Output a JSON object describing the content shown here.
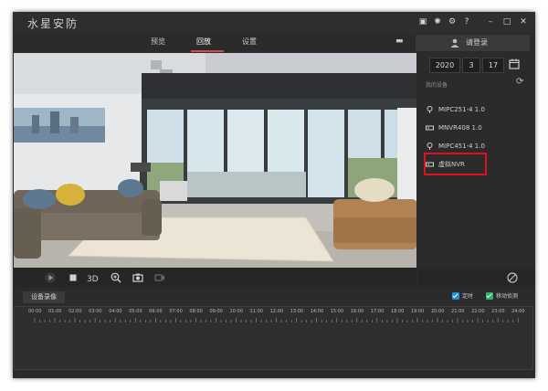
{
  "app": {
    "logo": "水星安防"
  },
  "nav": {
    "tabs": [
      {
        "label": "预览"
      },
      {
        "label": "回放"
      },
      {
        "label": "设置"
      }
    ],
    "active_tab": "回放",
    "login_label": "请登录"
  },
  "date": {
    "year": "2020",
    "month": "3",
    "day": "17"
  },
  "devices": {
    "section_title": "我的设备",
    "items": [
      {
        "name": "MIPC251-4 1.0",
        "icon": "camera-icon"
      },
      {
        "name": "MNVR408 1.0",
        "icon": "nvr-icon"
      },
      {
        "name": "MIPC451-4 1.0",
        "icon": "camera-icon"
      },
      {
        "name": "虚拟NVR",
        "icon": "nvr-icon",
        "highlighted": true
      }
    ]
  },
  "playback": {
    "device_record_label": "设备录像",
    "timed_label": "定时",
    "motion_label": "移动侦测",
    "timed_checked": true,
    "motion_checked": true,
    "time_ticks": [
      "00:00",
      "01:00",
      "02:00",
      "03:00",
      "04:00",
      "05:00",
      "06:00",
      "07:00",
      "08:00",
      "09:00",
      "10:00",
      "11:00",
      "12:00",
      "13:00",
      "14:00",
      "15:00",
      "16:00",
      "17:00",
      "18:00",
      "19:00",
      "20:00",
      "21:00",
      "22:00",
      "23:00",
      "24:00"
    ]
  },
  "colors": {
    "accent": "#d64a4a",
    "highlight_box": "#e0111d",
    "timed": "#1f8fd0",
    "motion": "#2fae6b"
  }
}
